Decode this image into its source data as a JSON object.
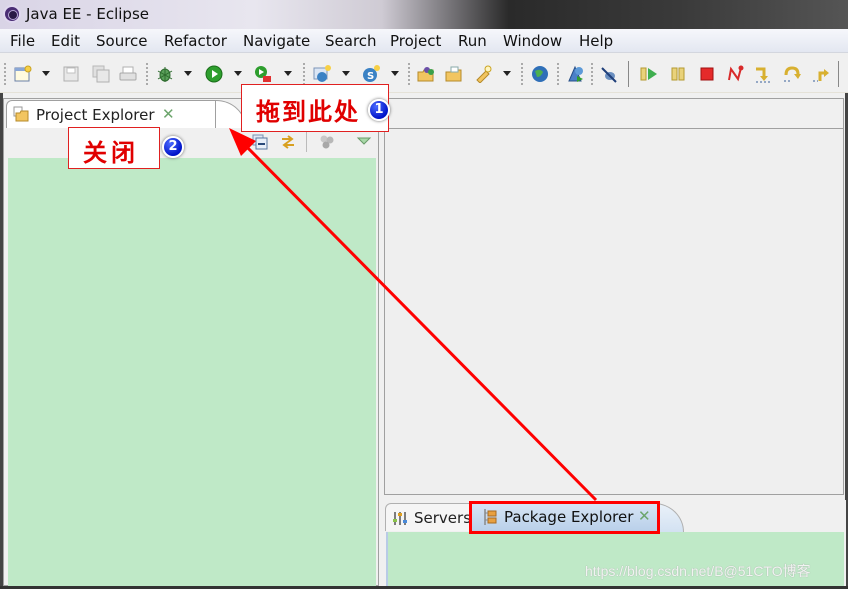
{
  "window": {
    "title": "Java EE - Eclipse",
    "app_icon": "eclipse-icon"
  },
  "menubar": {
    "items": [
      "File",
      "Edit",
      "Source",
      "Refactor",
      "Navigate",
      "Search",
      "Project",
      "Run",
      "Window",
      "Help"
    ]
  },
  "toolbar": {
    "icons": [
      "new-wizard-icon",
      "save-icon",
      "save-all-icon",
      "print-icon",
      "debug-icon",
      "run-icon",
      "run-server-icon",
      "new-java-ee-project-icon",
      "new-servlet-icon",
      "open-type-icon",
      "open-folder-icon",
      "search-flashlight-icon",
      "web-browser-icon",
      "run-on-server-icon",
      "skip-breakpoints-icon",
      "resume-icon",
      "suspend-icon",
      "terminate-icon",
      "disconnect-icon",
      "step-into-icon",
      "step-over-icon",
      "step-return-icon"
    ]
  },
  "left_view": {
    "tab_label": "Project Explorer",
    "tab_icon": "project-explorer-icon",
    "toolbar_icons": [
      "collapse-all-icon",
      "link-with-editor-icon",
      "focus-icon",
      "view-menu-icon"
    ]
  },
  "bottom_view": {
    "tabs": [
      {
        "label": "Servers",
        "icon": "servers-icon",
        "active": false
      },
      {
        "label": "Package Explorer",
        "icon": "package-explorer-icon",
        "active": true
      }
    ]
  },
  "annotations": {
    "callout_1": {
      "text": "拖到此处",
      "badge": "1"
    },
    "callout_2": {
      "text": "关闭",
      "badge": "2"
    },
    "arrow_color": "#ff0000"
  },
  "colors": {
    "view_background": "#bfe9c7",
    "callout_text": "#e00000",
    "badge_blue": "#0013c8"
  },
  "watermark": "https://blog.csdn.net/B@51CTO博客"
}
